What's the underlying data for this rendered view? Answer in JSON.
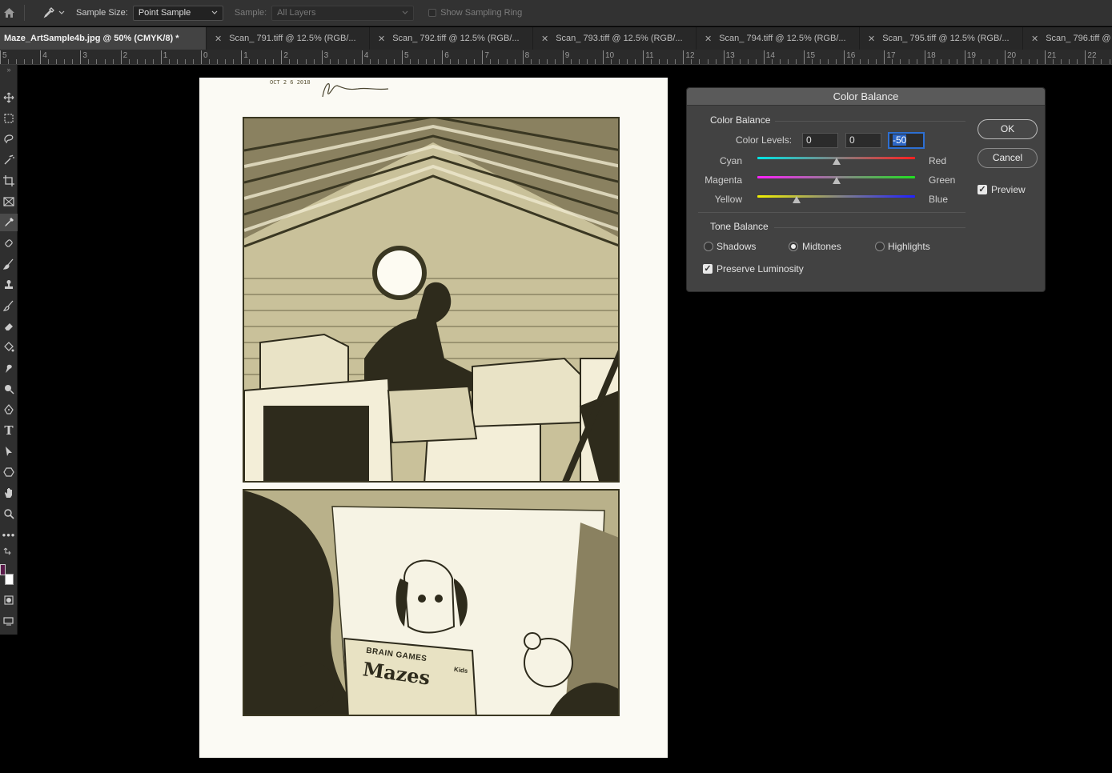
{
  "options_bar": {
    "sample_size_label": "Sample Size:",
    "sample_size_value": "Point Sample",
    "sample_label": "Sample:",
    "sample_value": "All Layers",
    "show_sampling_ring_label": "Show Sampling Ring"
  },
  "tabs": [
    {
      "label": "Maze_ArtSample4b.jpg @ 50% (CMYK/8) *",
      "active": true
    },
    {
      "label": "Scan_ 791.tiff @ 12.5% (RGB/..."
    },
    {
      "label": "Scan_ 792.tiff @ 12.5% (RGB/..."
    },
    {
      "label": "Scan_ 793.tiff @ 12.5% (RGB/..."
    },
    {
      "label": "Scan_ 794.tiff @ 12.5% (RGB/..."
    },
    {
      "label": "Scan_ 795.tiff @ 12.5% (RGB/..."
    },
    {
      "label": "Scan_ 796.tiff @"
    }
  ],
  "ruler": {
    "labels": [
      "5",
      "4",
      "3",
      "2",
      "1",
      "0",
      "1",
      "2",
      "3",
      "4",
      "5",
      "6",
      "7",
      "8",
      "9",
      "10",
      "11",
      "12",
      "13",
      "14",
      "15",
      "16",
      "17",
      "18",
      "19",
      "20",
      "21",
      "22"
    ]
  },
  "artwork": {
    "date_stamp": "OCT 2 6 2018",
    "box_text_1": "BRAIN GAMES",
    "box_text_2": "Mazes",
    "box_text_3": "Kids"
  },
  "dialog": {
    "title": "Color Balance",
    "color_balance_group": "Color Balance",
    "color_levels_label": "Color Levels:",
    "levels": [
      "0",
      "0",
      "-50"
    ],
    "sliders": [
      {
        "left": "Cyan",
        "right": "Red",
        "value": 0,
        "left_color": "#00e5e5",
        "right_color": "#ff2020"
      },
      {
        "left": "Magenta",
        "right": "Green",
        "value": 0,
        "left_color": "#ff20ff",
        "right_color": "#20e020"
      },
      {
        "left": "Yellow",
        "right": "Blue",
        "value": -50,
        "left_color": "#f0f000",
        "right_color": "#2020ff"
      }
    ],
    "tone_balance_group": "Tone Balance",
    "tones": [
      {
        "label": "Shadows",
        "selected": false
      },
      {
        "label": "Midtones",
        "selected": true
      },
      {
        "label": "Highlights",
        "selected": false
      }
    ],
    "preserve_luminosity_label": "Preserve Luminosity",
    "preserve_luminosity": true,
    "ok_label": "OK",
    "cancel_label": "Cancel",
    "preview_label": "Preview",
    "preview": true
  },
  "colors": {
    "foreground": "#5a1a4a",
    "background": "#ffffff"
  }
}
